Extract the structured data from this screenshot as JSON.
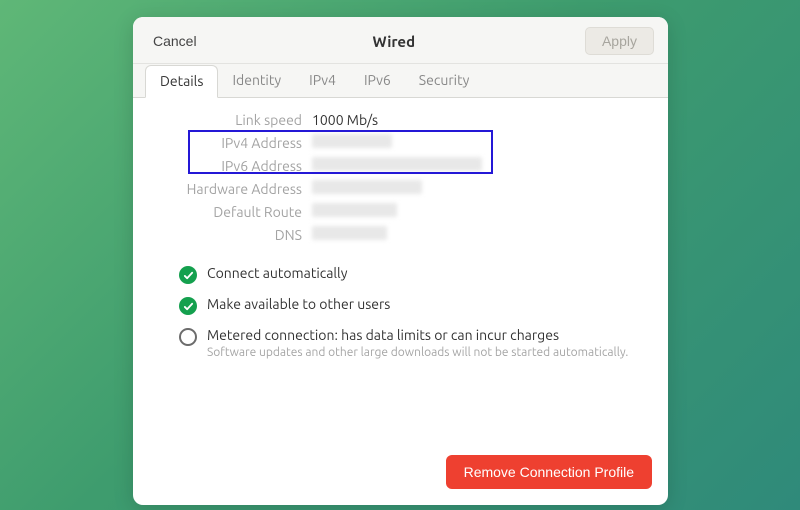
{
  "header": {
    "cancel_label": "Cancel",
    "title": "Wired",
    "apply_label": "Apply"
  },
  "tabs": {
    "details": "Details",
    "identity": "Identity",
    "ipv4": "IPv4",
    "ipv6": "IPv6",
    "security": "Security"
  },
  "details": {
    "link_speed_label": "Link speed",
    "link_speed_value": "1000 Mb/s",
    "ipv4_address_label": "IPv4 Address",
    "ipv6_address_label": "IPv6 Address",
    "hardware_address_label": "Hardware Address",
    "default_route_label": "Default Route",
    "dns_label": "DNS"
  },
  "options": {
    "connect_auto": "Connect automatically",
    "make_available": "Make available to other users",
    "metered_title": "Metered connection: has data limits or can incur charges",
    "metered_sub": "Software updates and other large downloads will not be started automatically."
  },
  "footer": {
    "remove_label": "Remove Connection Profile"
  }
}
